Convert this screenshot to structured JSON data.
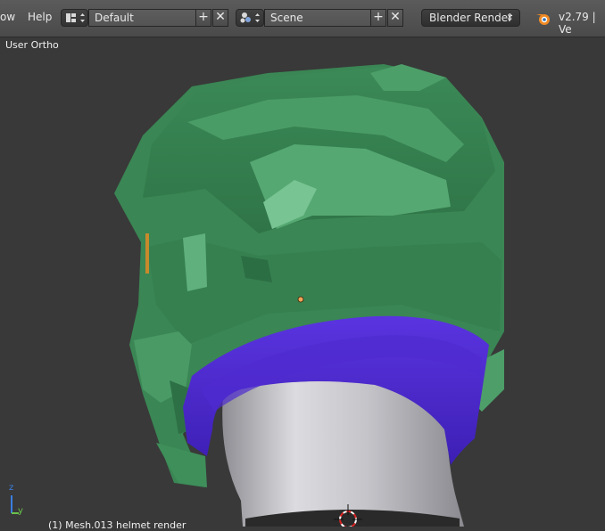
{
  "menu": {
    "window_partial": "ow",
    "help": "Help"
  },
  "screen_layout": {
    "value": "Default",
    "icon": "layout-icon"
  },
  "scene": {
    "value": "Scene",
    "icon": "scene-icon"
  },
  "buttons": {
    "add": "+",
    "remove": "✕"
  },
  "render_engine": {
    "value": "Blender Render",
    "arrows": "⇕"
  },
  "version": {
    "text": "v2.79 | Ve",
    "icon": "blender-logo-icon"
  },
  "viewport": {
    "view_label": "User Ortho",
    "object_label": "(1) Mesh.013 helmet render",
    "axis_z": "z",
    "axis_y": "y"
  },
  "colors": {
    "helmet_green": "#3f8f5b",
    "visor_purple": "#4a25c8",
    "head_grey": "#c8c8cc",
    "background": "#393939"
  }
}
